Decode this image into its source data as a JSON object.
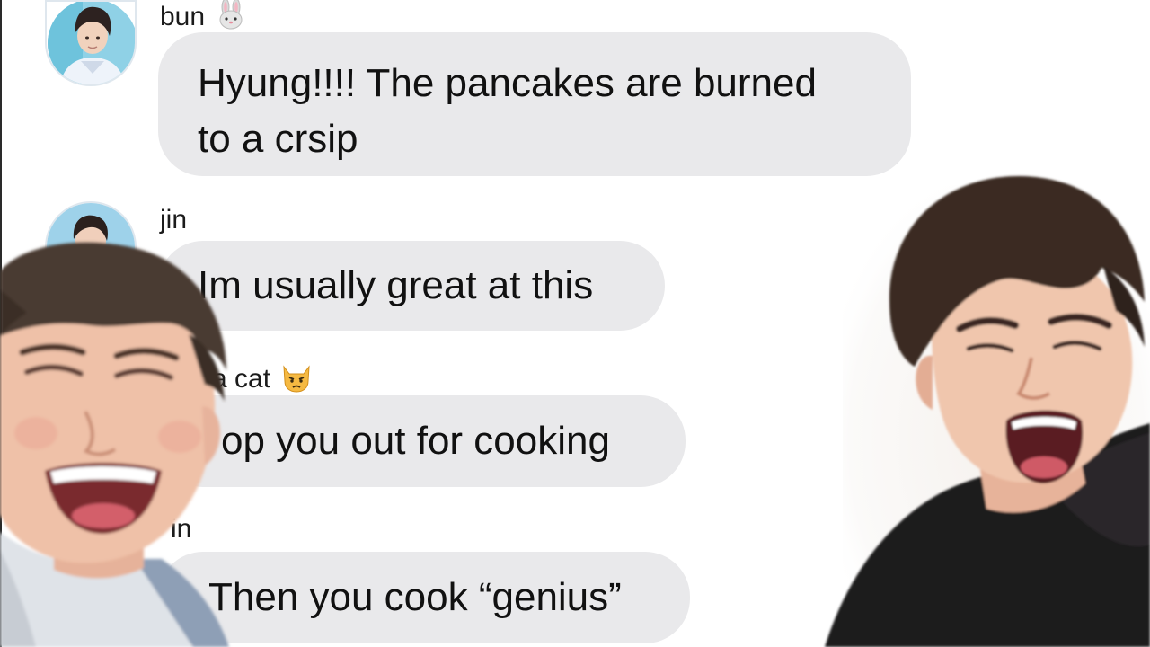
{
  "messages": [
    {
      "sender": "bun",
      "sender_emoji_icon": "rabbit-face-icon",
      "text": "Hyung!!!! The pancakes are burned\nto a crsip",
      "avatar_icon": "avatar-photo-icon"
    },
    {
      "sender": "jin",
      "text": "Im usually great at this",
      "avatar_icon": "avatar-photo-icon"
    },
    {
      "sender": "a cat",
      "sender_emoji_icon": "pouting-cat-face-icon",
      "text": "op you out for cooking"
    },
    {
      "sender": "in",
      "text": "Then you cook “genius”"
    }
  ],
  "overlays": [
    {
      "icon": "laughing-person-photo-icon"
    },
    {
      "icon": "shouting-person-photo-icon"
    }
  ],
  "colors": {
    "bubble": "#e9e9eb",
    "text": "#111111",
    "background": "#ffffff"
  }
}
